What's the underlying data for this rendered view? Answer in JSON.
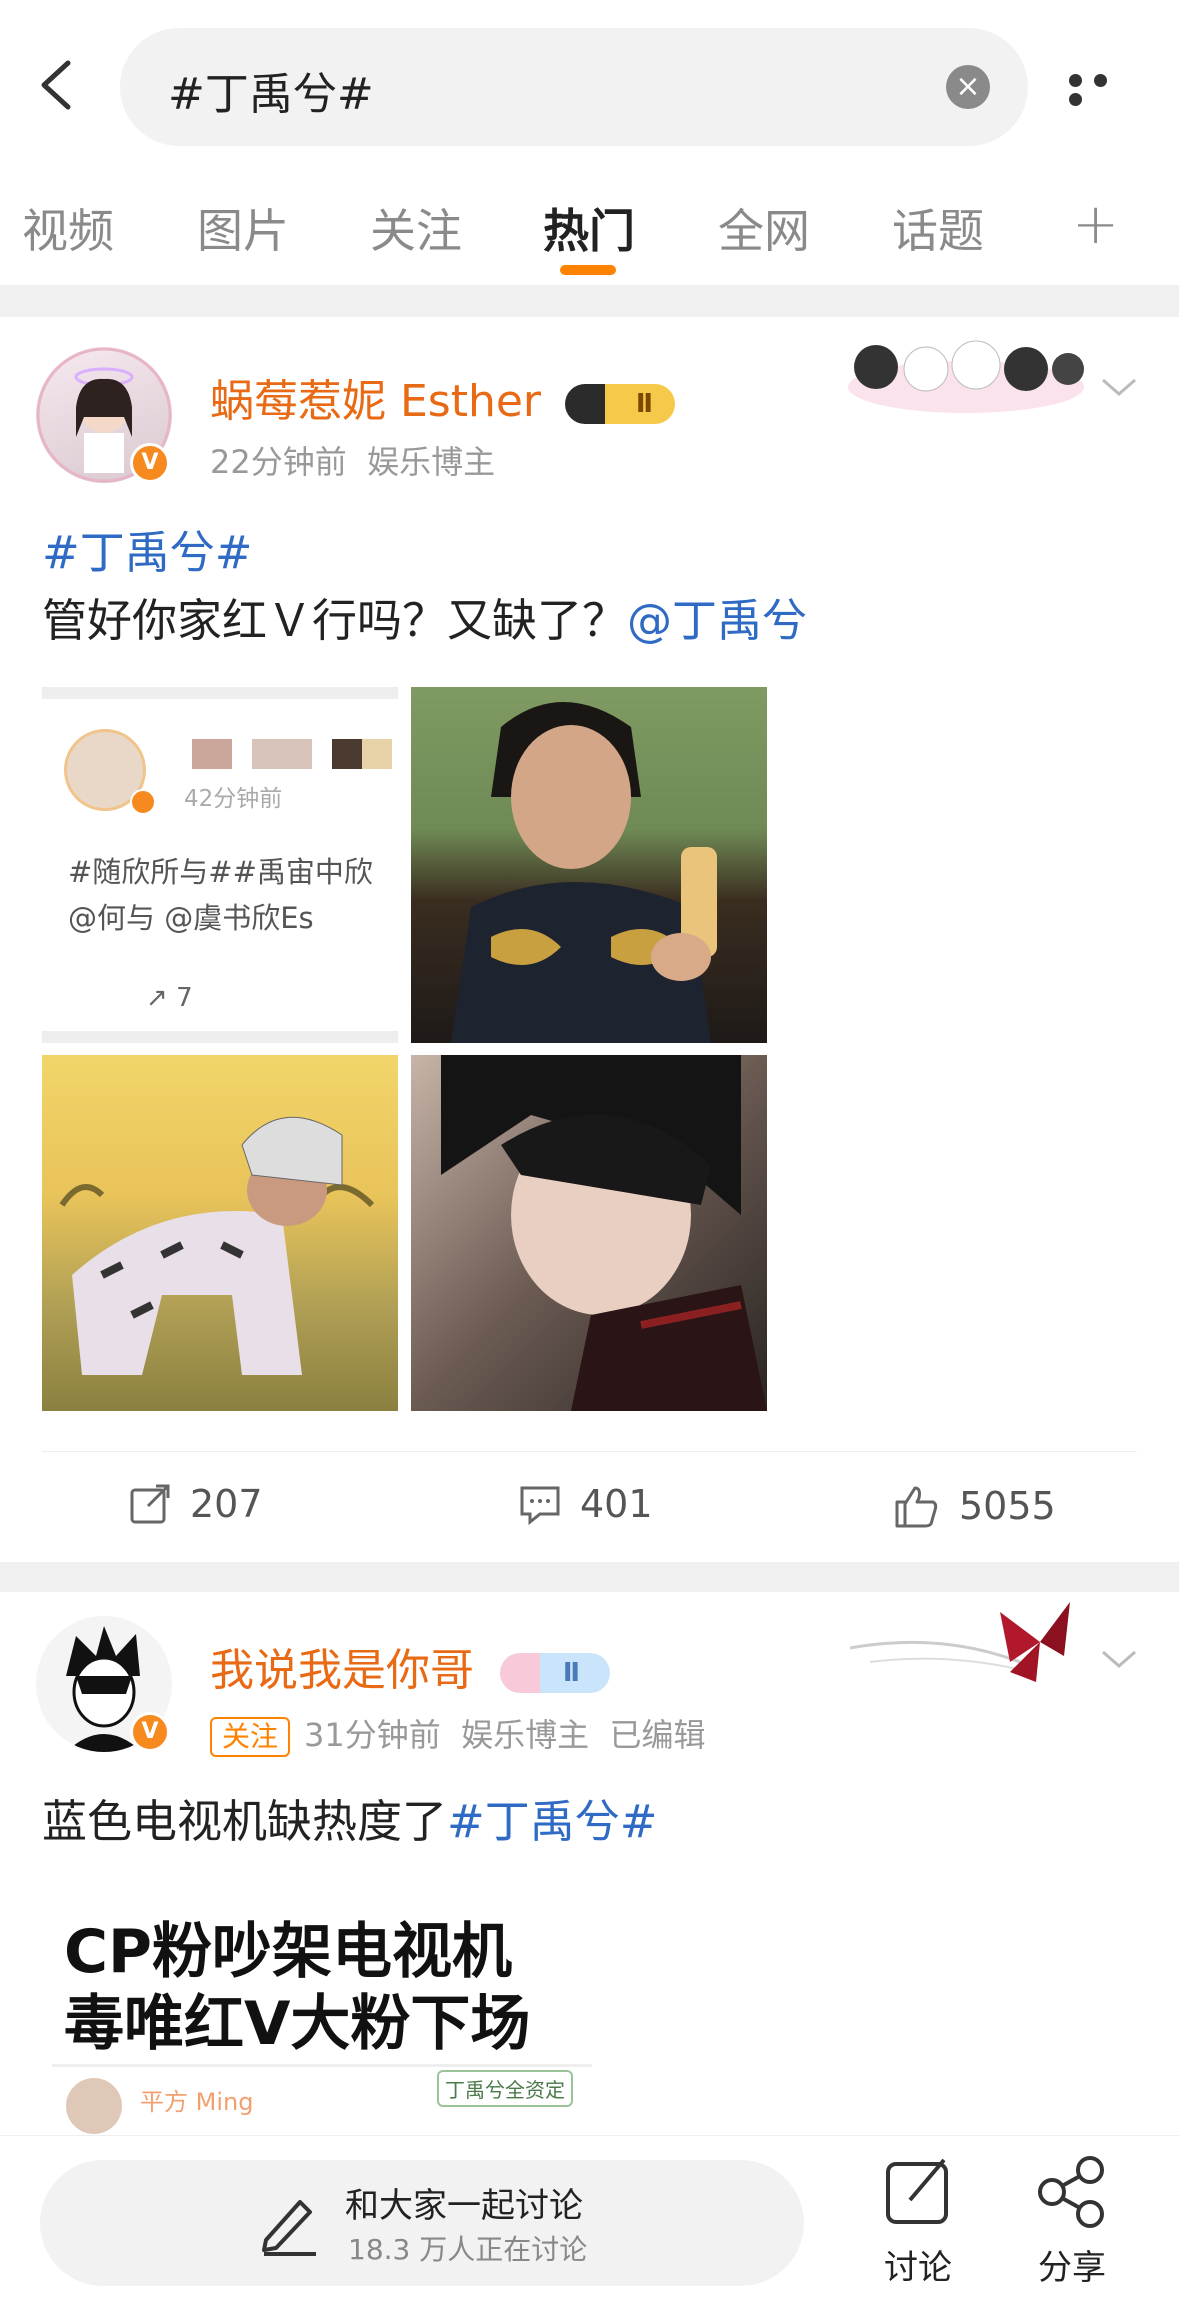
{
  "search": {
    "query": "#丁禹兮#"
  },
  "tabs": [
    {
      "label": "视频"
    },
    {
      "label": "图片"
    },
    {
      "label": "关注"
    },
    {
      "label": "热门"
    },
    {
      "label": "全网"
    },
    {
      "label": "话题"
    }
  ],
  "active_tab": "热门",
  "posts": [
    {
      "username": "蜗莓惹妮 Esther",
      "level_badge": "Ⅱ",
      "time": "22分钟前",
      "role": "娱乐博主",
      "hashtag": "#丁禹兮#",
      "text": "管好你家红Ｖ行吗？又缺了？",
      "mention": "@丁禹兮",
      "embedded": {
        "time": "42分钟前",
        "line1": "#随欣所与##禹宙中欣",
        "line2": "@何与 @虞书欣Es",
        "repost_count": "7"
      },
      "stats": {
        "reposts": "207",
        "comments": "401",
        "likes": "5055"
      }
    },
    {
      "username": "我说我是你哥",
      "level_badge": "Ⅱ",
      "follow_label": "关注",
      "time": "31分钟前",
      "role": "娱乐博主",
      "edited": "已编辑",
      "text": "蓝色电视机缺热度了",
      "hashtag": "#丁禹兮#",
      "image_title_line1": "CP粉吵架电视机",
      "image_title_line2": "毒唯红V大粉下场",
      "image_sub_name": "平方 Ming",
      "image_sub_tag": "丁禹兮全资定"
    }
  ],
  "bottom": {
    "discuss_title": "和大家一起讨论",
    "discuss_sub": "18.3 万人正在讨论",
    "comment_label": "讨论",
    "share_label": "分享"
  },
  "colors": {
    "accent": "#ff8200",
    "username": "#e86a14",
    "link": "#2f6bc4"
  }
}
